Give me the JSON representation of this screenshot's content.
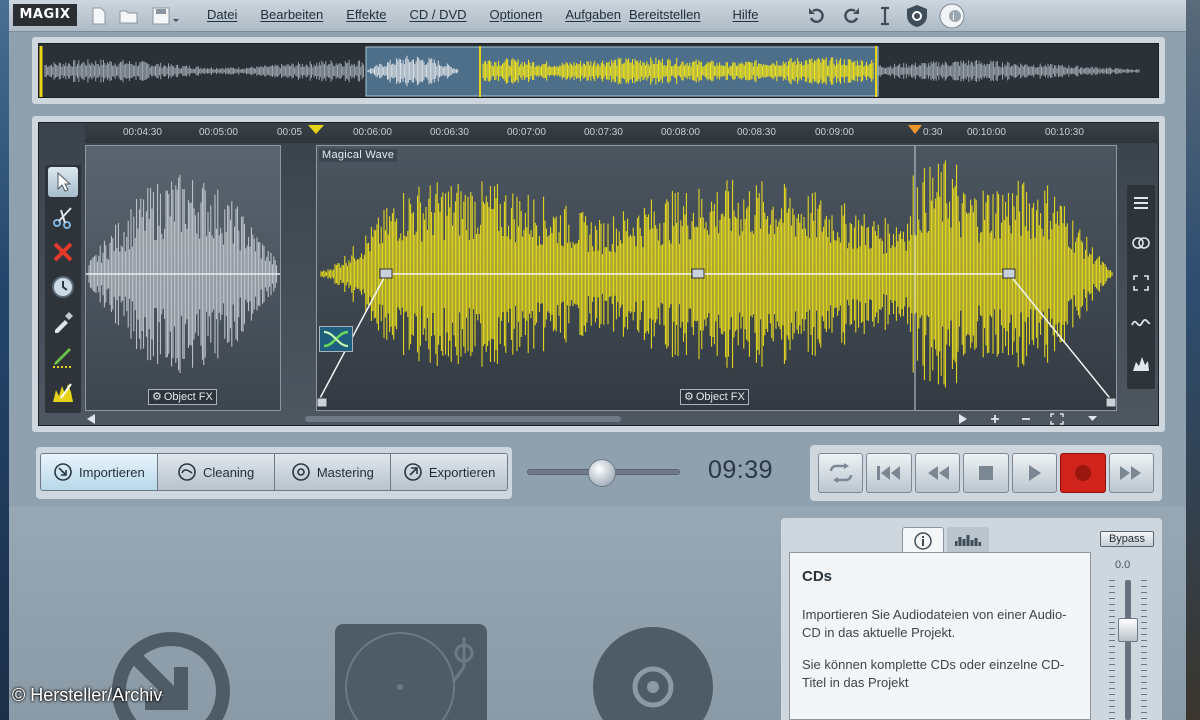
{
  "app": {
    "logo": "MAGIX"
  },
  "menu": {
    "items": [
      "Datei",
      "Bearbeiten",
      "Effekte",
      "CD / DVD",
      "Optionen",
      "Aufgaben",
      "Bereitstellen",
      "Hilfe"
    ]
  },
  "timeline": {
    "ticks": [
      "00:04:30",
      "00:05:00",
      "00:05",
      "00:06:00",
      "00:06:30",
      "00:07:00",
      "00:07:30",
      "00:08:00",
      "00:08:30",
      "00:09:00",
      "0:30",
      "00:10:00",
      "00:10:30"
    ]
  },
  "clips": {
    "main_title": "Magical Wave",
    "object_fx_label": "Object FX"
  },
  "modes": [
    {
      "label": "Importieren",
      "icon": "import-icon",
      "active": true
    },
    {
      "label": "Cleaning",
      "icon": "cleaning-icon",
      "active": false
    },
    {
      "label": "Mastering",
      "icon": "mastering-icon",
      "active": false
    },
    {
      "label": "Exportieren",
      "icon": "export-icon",
      "active": false
    }
  ],
  "transport": {
    "time": "09:39",
    "buttons": [
      "loop-icon",
      "skip-to-start-icon",
      "rewind-icon",
      "stop-icon",
      "play-icon",
      "record-icon",
      "fast-forward-icon"
    ]
  },
  "info_panel": {
    "bypass_label": "Bypass",
    "level": "0.0",
    "title": "CDs",
    "paragraph1": "Importieren Sie Audiodateien von einer Audio-CD in das aktuelle Projekt.",
    "paragraph2": "Sie können komplette CDs oder einzelne CD-Titel in das Projekt"
  },
  "credit": "© Hersteller/Archiv",
  "colors": {
    "waveform_active": "#f0e21c",
    "waveform_inactive": "#c4cbd1",
    "record": "#d0231c",
    "accent_blue": "#b8d8ea"
  }
}
